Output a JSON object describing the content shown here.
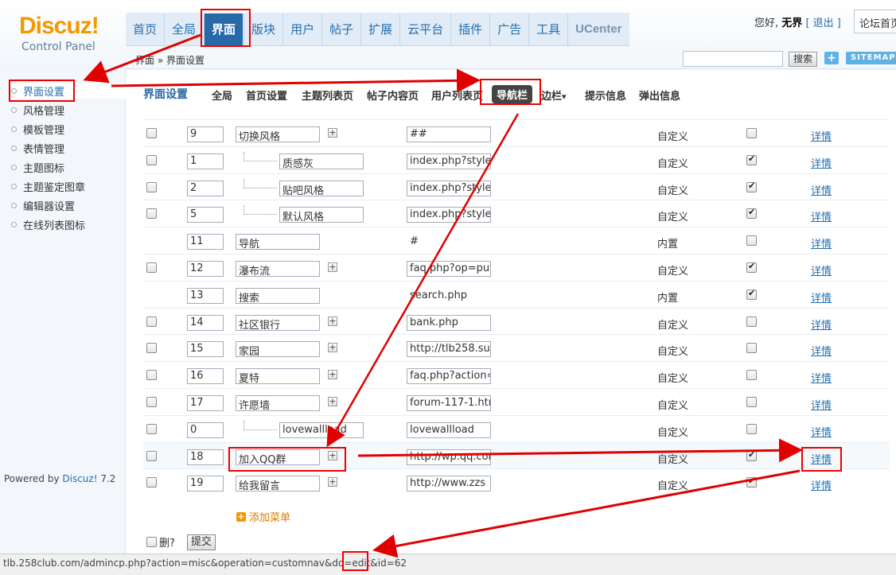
{
  "logo": {
    "brand": "Discuz!",
    "subtitle": "Control Panel"
  },
  "main_nav": [
    "首页",
    "全局",
    "界面",
    "版块",
    "用户",
    "帖子",
    "扩展",
    "云平台",
    "插件",
    "广告",
    "工具",
    "UCenter"
  ],
  "main_nav_active": "界面",
  "header": {
    "greeting": "您好,",
    "username": "无界",
    "logout": "[ 退出 ]",
    "quick_jump": "论坛首页"
  },
  "breadcrumb": "界面 » 界面设置",
  "search": {
    "button": "搜索",
    "add": "+",
    "sitemap": "SITEMAP"
  },
  "sidebar": {
    "items": [
      "界面设置",
      "风格管理",
      "模板管理",
      "表情管理",
      "主题图标",
      "主题鉴定图章",
      "编辑器设置",
      "在线列表图标"
    ],
    "active": "界面设置"
  },
  "page": {
    "title": "界面设置",
    "tabs": [
      "全局",
      "首页设置",
      "主题列表页",
      "帖子内容页",
      "用户列表页",
      "导航栏",
      "边栏",
      "提示信息",
      "弹出信息"
    ],
    "active_tab": "导航栏",
    "dropdown_arrow": "▾"
  },
  "rows": [
    {
      "order": "9",
      "name": "切换风格",
      "level": 0,
      "has_plus": true,
      "url": "##",
      "type": "自定义",
      "has_select": true,
      "enabled": false,
      "detail": "详情"
    },
    {
      "order": "1",
      "name": "质感灰",
      "level": 1,
      "has_plus": false,
      "url": "index.php?style",
      "type": "自定义",
      "has_select": true,
      "enabled": true,
      "detail": "详情"
    },
    {
      "order": "2",
      "name": "贴吧风格",
      "level": 1,
      "has_plus": false,
      "url": "index.php?style",
      "type": "自定义",
      "has_select": true,
      "enabled": true,
      "detail": "详情"
    },
    {
      "order": "5",
      "name": "默认风格",
      "level": 1,
      "has_plus": false,
      "url": "index.php?style",
      "type": "自定义",
      "has_select": true,
      "enabled": true,
      "detail": "详情"
    },
    {
      "order": "11",
      "name": "导航",
      "level": 0,
      "has_plus": false,
      "url": "#",
      "url_plain": true,
      "type": "内置",
      "has_select": false,
      "enabled": false,
      "detail": "详情"
    },
    {
      "order": "12",
      "name": "瀑布流",
      "level": 0,
      "has_plus": true,
      "url": "faq.php?op=put",
      "type": "自定义",
      "has_select": true,
      "enabled": true,
      "detail": "详情"
    },
    {
      "order": "13",
      "name": "搜索",
      "level": 0,
      "has_plus": false,
      "url": "search.php",
      "url_plain": true,
      "type": "内置",
      "has_select": false,
      "enabled": true,
      "detail": "详情"
    },
    {
      "order": "14",
      "name": "社区银行",
      "level": 0,
      "has_plus": true,
      "url": "bank.php",
      "type": "自定义",
      "has_select": true,
      "enabled": false,
      "detail": "详情"
    },
    {
      "order": "15",
      "name": "家园",
      "level": 0,
      "has_plus": true,
      "url": "http://tlb258.su",
      "type": "自定义",
      "has_select": true,
      "enabled": false,
      "detail": "详情"
    },
    {
      "order": "16",
      "name": "夏特",
      "level": 0,
      "has_plus": true,
      "url": "faq.php?action=",
      "type": "自定义",
      "has_select": true,
      "enabled": false,
      "detail": "详情"
    },
    {
      "order": "17",
      "name": "许愿墙",
      "level": 0,
      "has_plus": true,
      "url": "forum-117-1.htm",
      "type": "自定义",
      "has_select": true,
      "enabled": false,
      "detail": "详情"
    },
    {
      "order": "0",
      "name": "lovewallload",
      "level": 1,
      "has_plus": false,
      "url": "lovewallload",
      "type": "自定义",
      "has_select": true,
      "enabled": false,
      "detail": "详情"
    },
    {
      "order": "18",
      "name": "加入QQ群",
      "level": 0,
      "has_plus": true,
      "url": "http://wp.qq.com",
      "type": "自定义",
      "has_select": true,
      "enabled": true,
      "detail": "详情",
      "highlight": true
    },
    {
      "order": "19",
      "name": "给我留言",
      "level": 0,
      "has_plus": true,
      "url": "http://www.zzs",
      "type": "自定义",
      "has_select": true,
      "enabled": true,
      "detail": "详情"
    }
  ],
  "add_menu": "添加菜单",
  "delete_label": "删?",
  "submit": "提交",
  "powered": {
    "prefix": "Powered by ",
    "brand": "Discuz!",
    "version": " 7.2"
  },
  "status_url": "tlb.258club.com/admincp.php?action=misc&operation=customnav&do=edit&id=62",
  "annotation_color": "#e00000"
}
